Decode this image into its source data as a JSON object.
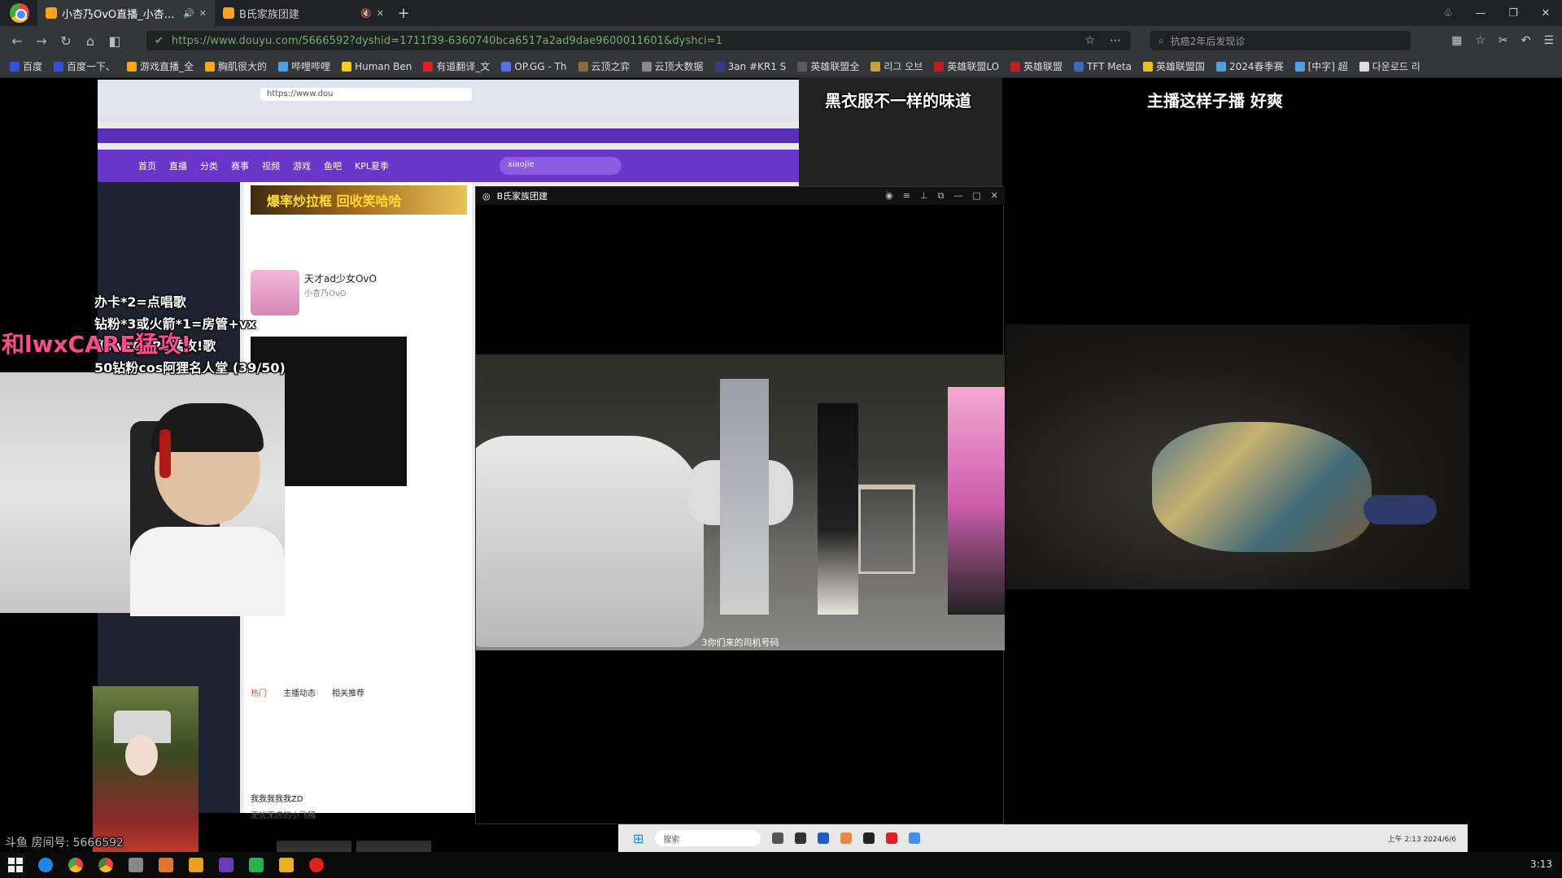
{
  "browser": {
    "tabs": [
      {
        "title": "小杏乃OvO直播_小杏乃OvO视频直播 - 斗鱼直播",
        "audio": "🔊",
        "close": "✕"
      },
      {
        "title": "B氏家族团建",
        "audio": "🔇",
        "close": "✕"
      }
    ],
    "new_tab": "+",
    "url": "https://www.douyu.com/5666592?dyshid=1711f39-6360740bca6517a2ad9dae9600011601&dyshci=1",
    "search_placeholder": "抗癌2年后发现诊",
    "bookmarks": [
      {
        "label": "百度",
        "color": "#2f55d4"
      },
      {
        "label": "百度一下、",
        "color": "#2f55d4"
      },
      {
        "label": "游戏直播_全",
        "color": "#f6a623"
      },
      {
        "label": "胸肌很大的",
        "color": "#f6a623"
      },
      {
        "label": "哔哩哔哩",
        "color": "#4aa3df"
      },
      {
        "label": "Human Ben",
        "color": "#f6c623"
      },
      {
        "label": "有道翻译_文",
        "color": "#e02020"
      },
      {
        "label": "OP.GG - Th",
        "color": "#5a6ee8"
      },
      {
        "label": "云顶之弈",
        "color": "#8a6a3a"
      },
      {
        "label": "云顶大数据",
        "color": "#8a8a8a"
      },
      {
        "label": "3an #KR1 S",
        "color": "#3a3a8a"
      },
      {
        "label": "英雄联盟全",
        "color": "#5a5a5a"
      },
      {
        "label": "리그 오브",
        "color": "#c8a040"
      },
      {
        "label": "英雄联盟LO",
        "color": "#c02020"
      },
      {
        "label": "英雄联盟",
        "color": "#c02020"
      },
      {
        "label": "TFT Meta",
        "color": "#3a6ab8"
      },
      {
        "label": "英雄联盟国",
        "color": "#e8c020"
      },
      {
        "label": "2024春季赛",
        "color": "#4aa3df"
      },
      {
        "label": "[中字] 超",
        "color": "#4aa3df"
      },
      {
        "label": "다운로드 리",
        "color": "#dddddd"
      }
    ]
  },
  "stream": {
    "overlay_rules": [
      "办卡*2=点唱歌",
      "钻粉*3或火箭*1=房管+vx",
      "和lwxCARE猛攻!歌",
      "50钻粉cos阿狸名人堂 (39/50)"
    ],
    "overlay_big": "和lwxCARE猛攻!",
    "top_caption_left": "黑衣服不一样的味道",
    "top_caption_right": "主播这样子播 好爽",
    "room_id": "斗鱼 房间号: 5666592",
    "player_title": "B氏家族团建",
    "video_subtitle": "3你们来的司机号码",
    "nested": {
      "address": "https://www.dou",
      "nav_items": [
        "首页",
        "直播",
        "分类",
        "赛事",
        "视频",
        "游戏",
        "鱼吧",
        "KPL夏季"
      ],
      "search_text": "xiaojie",
      "banner": "爆率炒拉框 回收笑哈哈",
      "streamer_name": "天才ad少女OvO",
      "streamer_sub": "小杏乃OvO",
      "tabs": [
        "热门",
        "主播动态",
        "相关推荐"
      ],
      "comment_user": "我我我我我ZD",
      "comment_text": "无忧无虑的小飞猪"
    },
    "mini_taskbar": {
      "search": "搜索",
      "clock": "上午 2:13 2024/6/6"
    }
  },
  "taskbar": {
    "clock": "3:13",
    "icons": [
      "edge",
      "chrome",
      "browser-360",
      "file",
      "game",
      "app",
      "app",
      "app",
      "app"
    ]
  }
}
